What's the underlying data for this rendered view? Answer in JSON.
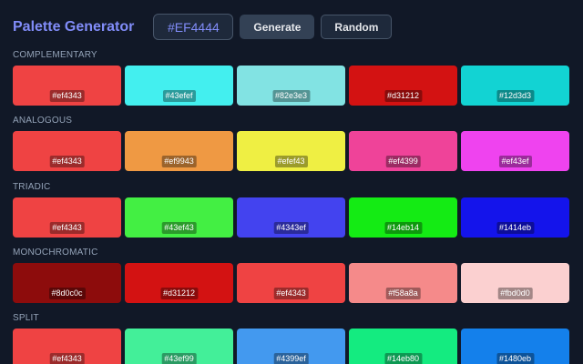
{
  "header": {
    "title": "Palette Generator",
    "hex_value": "#EF4444",
    "generate_label": "Generate",
    "random_label": "Random"
  },
  "sections": [
    {
      "label": "COMPLEMENTARY",
      "swatches": [
        {
          "hex": "#ef4343",
          "color": "#ef4343"
        },
        {
          "hex": "#43efef",
          "color": "#43efef"
        },
        {
          "hex": "#82e3e3",
          "color": "#82e3e3"
        },
        {
          "hex": "#d31212",
          "color": "#d31212"
        },
        {
          "hex": "#12d3d3",
          "color": "#12d3d3"
        }
      ]
    },
    {
      "label": "ANALOGOUS",
      "swatches": [
        {
          "hex": "#ef4343",
          "color": "#ef4343"
        },
        {
          "hex": "#ef9943",
          "color": "#ef9943"
        },
        {
          "hex": "#efef43",
          "color": "#efef43"
        },
        {
          "hex": "#ef4399",
          "color": "#ef4399"
        },
        {
          "hex": "#ef43ef",
          "color": "#ef43ef"
        }
      ]
    },
    {
      "label": "TRIADIC",
      "swatches": [
        {
          "hex": "#ef4343",
          "color": "#ef4343"
        },
        {
          "hex": "#43ef43",
          "color": "#43ef43"
        },
        {
          "hex": "#4343ef",
          "color": "#4343ef"
        },
        {
          "hex": "#14eb14",
          "color": "#14eb14"
        },
        {
          "hex": "#1414eb",
          "color": "#1414eb"
        }
      ]
    },
    {
      "label": "MONOCHROMATIC",
      "swatches": [
        {
          "hex": "#8d0c0c",
          "color": "#8d0c0c"
        },
        {
          "hex": "#d31212",
          "color": "#d31212"
        },
        {
          "hex": "#ef4343",
          "color": "#ef4343"
        },
        {
          "hex": "#f58a8a",
          "color": "#f58a8a"
        },
        {
          "hex": "#fbd0d0",
          "color": "#fbd0d0"
        }
      ]
    },
    {
      "label": "SPLIT",
      "swatches": [
        {
          "hex": "#ef4343",
          "color": "#ef4343"
        },
        {
          "hex": "#43ef99",
          "color": "#43ef99"
        },
        {
          "hex": "#4399ef",
          "color": "#4399ef"
        },
        {
          "hex": "#14eb80",
          "color": "#14eb80"
        },
        {
          "hex": "#1480eb",
          "color": "#1480eb"
        }
      ]
    }
  ]
}
